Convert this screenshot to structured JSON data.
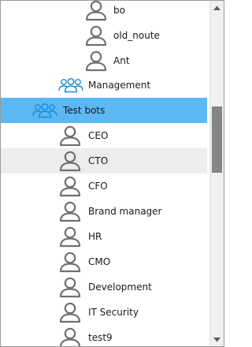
{
  "tree": {
    "items": [
      {
        "label": "bo",
        "type": "user",
        "masked": true
      },
      {
        "label": "old_noute",
        "type": "user",
        "masked": false
      },
      {
        "label": "Ant",
        "type": "user",
        "masked": true
      },
      {
        "label": "Management",
        "type": "group",
        "masked": false
      },
      {
        "label": "Test bots",
        "type": "group",
        "masked": false,
        "selected": true
      },
      {
        "label": "CEO",
        "type": "user",
        "masked": false
      },
      {
        "label": "CTO",
        "type": "user",
        "masked": false,
        "hover": true
      },
      {
        "label": "CFO",
        "type": "user",
        "masked": false
      },
      {
        "label": "Brand manager",
        "type": "user",
        "masked": false
      },
      {
        "label": "HR",
        "type": "user",
        "masked": false
      },
      {
        "label": "CMO",
        "type": "user",
        "masked": false
      },
      {
        "label": "Development",
        "type": "user",
        "masked": false
      },
      {
        "label": "IT Security",
        "type": "user",
        "masked": false
      },
      {
        "label": "test9",
        "type": "user",
        "masked": false
      }
    ]
  },
  "icons": {
    "user": "person-outline-icon",
    "group": "group-people-icon",
    "scroll_up": "arrow-up-icon",
    "scroll_down": "arrow-down-icon"
  },
  "colors": {
    "selected_row": "#5bb8f3",
    "hover_row": "#ededed",
    "user_icon": "#707070",
    "group_icon": "#1a8fd6",
    "scroll_thumb": "#858585"
  }
}
